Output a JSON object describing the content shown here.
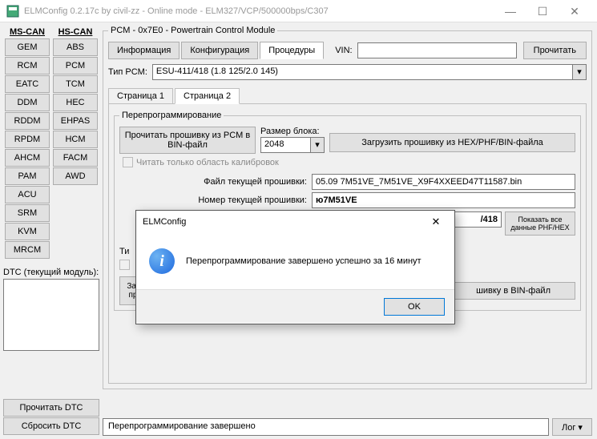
{
  "window": {
    "title": "ELMConfig 0.2.17c by civil-zz - Online mode - ELM327/VCP/500000bps/C307"
  },
  "buses": {
    "ms": "MS-CAN",
    "hs": "HS-CAN"
  },
  "msModules": [
    "GEM",
    "RCM",
    "EATC",
    "DDM",
    "RDDM",
    "RPDM",
    "AHCM",
    "PAM",
    "ACU",
    "SRM",
    "KVM",
    "MRCM"
  ],
  "hsModules": [
    "ABS",
    "PCM",
    "TCM",
    "HEC",
    "EHPAS",
    "HCM",
    "FACM",
    "AWD"
  ],
  "dtc": {
    "label": "DTC (текущий модуль):",
    "read": "Прочитать DTC",
    "reset": "Сбросить DTC"
  },
  "pcm": {
    "fieldset": "PCM - 0x7E0 - Powertrain Control Module",
    "tabs": {
      "info": "Информация",
      "config": "Конфигурация",
      "proc": "Процедуры"
    },
    "vinLabel": "VIN:",
    "readBtn": "Прочитать",
    "typLabel": "Тип PCM:",
    "typValue": "ESU-411/418 (1.8 125/2.0 145)",
    "pages": {
      "p1": "Страница 1",
      "p2": "Страница 2"
    }
  },
  "reprog": {
    "legend": "Перепрограммирование",
    "readFw": "Прочитать прошивку из PCM в BIN-файл",
    "blockLabel": "Размер блока:",
    "blockValue": "2048",
    "loadFw": "Загрузить прошивку из HEX/PHF/BIN-файла",
    "calibOnly": "Читать только область калибровок",
    "curFwFileLabel": "Файл текущей прошивки:",
    "curFwFile": "05.09 7M51VE_7M51VE_X9F4XXEED47T11587.bin",
    "curFwNumLabel": "Номер текущей прошивки:",
    "curFwNum": "ю7M51VE",
    "f418": "/418",
    "showAll": "Показать все данные PHF/HEX",
    "ti": "Ти",
    "zag": "Заг\nпр",
    "saveBin": "шивку в BIN-файл"
  },
  "status": {
    "text": "Перепрограммирование завершено",
    "logBtn": "Лог ▾"
  },
  "dialog": {
    "title": "ELMConfig",
    "message": "Перепрограммирование завершено успешно за 16 минут",
    "ok": "OK"
  }
}
